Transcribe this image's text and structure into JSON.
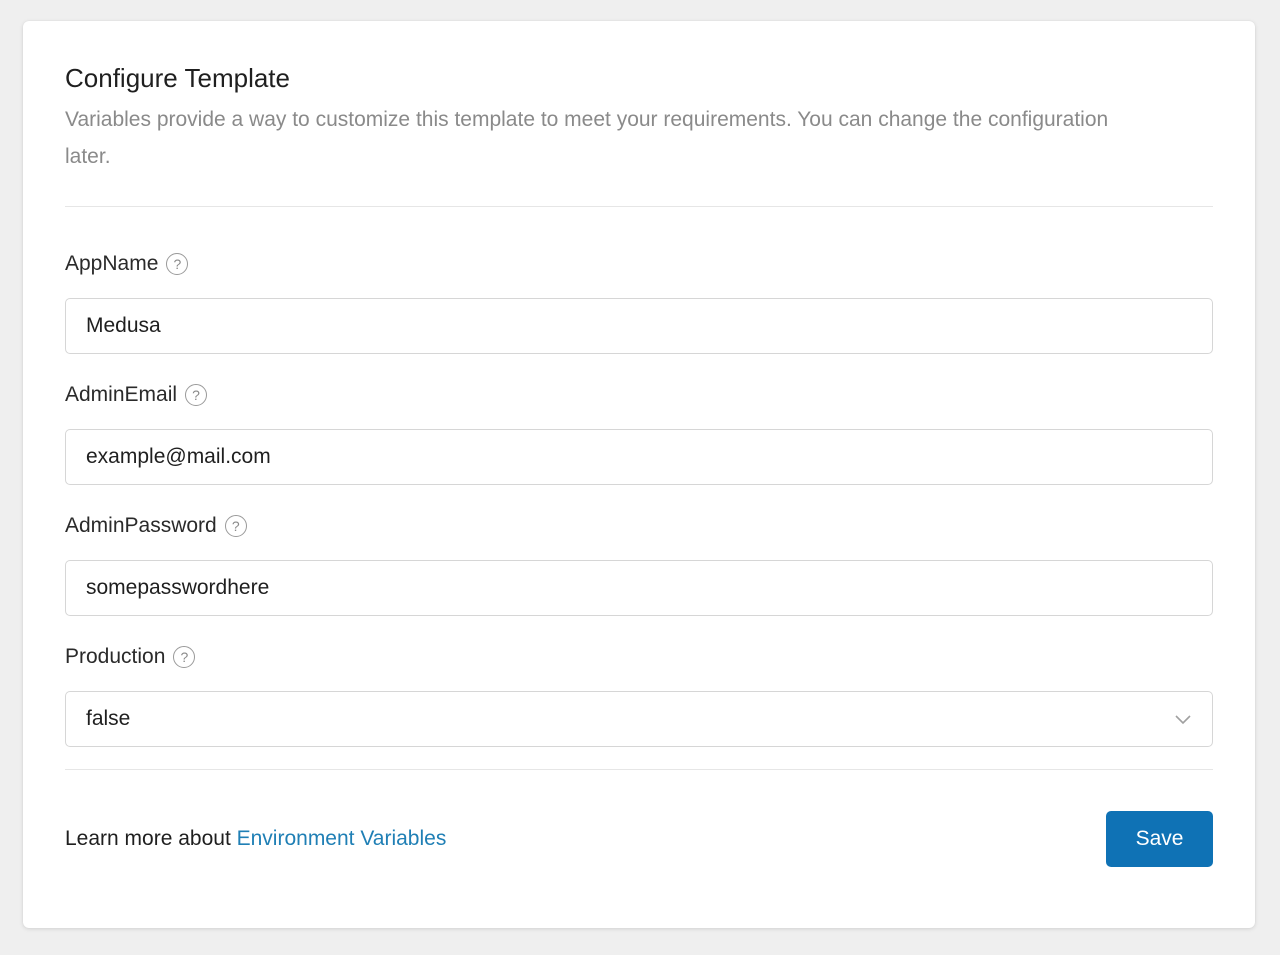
{
  "card": {
    "title": "Configure Template",
    "description": "Variables provide a way to customize this template to meet your requirements. You can change the configuration later."
  },
  "fields": [
    {
      "label": "AppName",
      "value": "Medusa"
    },
    {
      "label": "AdminEmail",
      "value": "example@mail.com"
    },
    {
      "label": "AdminPassword",
      "value": "somepasswordhere"
    },
    {
      "label": "Production",
      "value": "false"
    }
  ],
  "footer": {
    "prefix": "Learn more about ",
    "link_label": "Environment Variables",
    "save_label": "Save"
  },
  "icons": {
    "help": "help-circle-icon",
    "chevron": "chevron-down-icon"
  },
  "colors": {
    "accent": "#0f72b5",
    "link": "#1f7fb5"
  }
}
